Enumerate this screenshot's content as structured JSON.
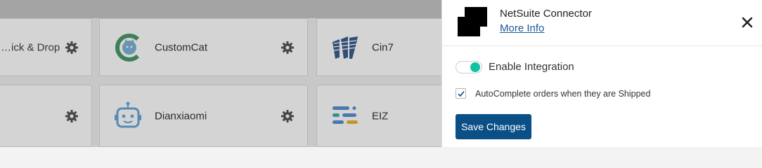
{
  "background": {
    "cards": [
      {
        "name": "…ick & Drop",
        "icon": "drag-drop-logo"
      },
      {
        "name": "CustomCat",
        "icon": "customcat-logo"
      },
      {
        "name": "Cin7",
        "icon": "cin7-logo"
      },
      {
        "name": "",
        "icon": ""
      },
      {
        "name": "Dianxiaomi",
        "icon": "dianxiaomi-robot-logo"
      },
      {
        "name": "EIZ",
        "icon": "eiz-logo"
      }
    ]
  },
  "panel": {
    "title": "NetSuite Connector",
    "more_info": "More Info",
    "enable_label": "Enable Integration",
    "enable_checked": true,
    "autocomplete_label": "AutoComplete orders when they are Shipped",
    "autocomplete_checked": true,
    "save_label": "Save Changes"
  },
  "colors": {
    "accent": "#0b4f87",
    "toggle_on": "#12c2a0",
    "link": "#1a5a96"
  }
}
